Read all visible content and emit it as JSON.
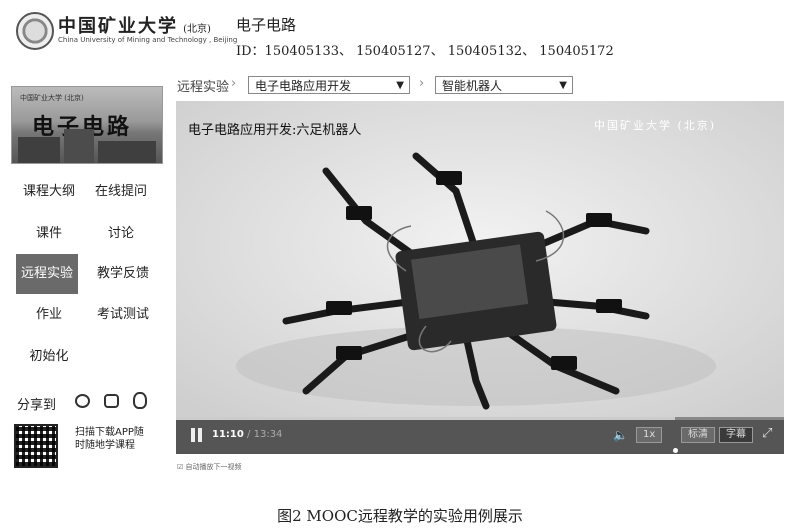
{
  "header": {
    "university_cn": "中国矿业大学",
    "university_suffix": "(北京)",
    "university_en": "China University of Mining and Technology , Beijing",
    "course_title": "电子电路",
    "ids": "ID：150405133、 150405127、 150405132、 150405172"
  },
  "breadcrumb": {
    "label": "远程实验",
    "select1": "电子电路应用开发",
    "select2": "智能机器人"
  },
  "sidebar": {
    "thumb_top": "中国矿业大学 (北京)",
    "thumb_title": "电子电路",
    "nav": [
      {
        "label": "课程大纲"
      },
      {
        "label": "在线提问"
      },
      {
        "label": "课件"
      },
      {
        "label": "讨论"
      },
      {
        "label": "远程实验"
      },
      {
        "label": "教学反馈"
      },
      {
        "label": "作业"
      },
      {
        "label": "考试测试"
      },
      {
        "label": "初始化"
      }
    ],
    "share_label": "分享到",
    "qr_text": "扫描下载APP随时随地学课程"
  },
  "video": {
    "title": "电子电路应用开发:六足机器人",
    "watermark": "中国矿业大学 (北京)",
    "current_time": "11:10",
    "total_time": "13:34",
    "speed": "1x",
    "quality1": "标清",
    "quality2": "字幕",
    "progress": 0.82
  },
  "autoplay_label": "自动播放下一视频",
  "caption": "图2   MOOC远程教学的实验用例展示"
}
